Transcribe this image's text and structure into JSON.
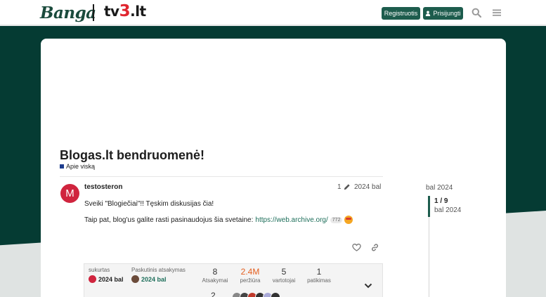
{
  "header": {
    "logo_left": "Banga",
    "logo_right_a": "tv",
    "logo_right_b": "3",
    "logo_right_c": ".lt",
    "register_label": "Registruotis",
    "login_label": "Prisijungti",
    "search_icon": "search-icon",
    "menu_icon": "hamburger-menu-icon"
  },
  "topic": {
    "title": "Blogas.lt bendruomenė!",
    "category": "Apie viską",
    "category_color": "#1e3d8e"
  },
  "post": {
    "avatar_letter": "M",
    "avatar_color": "#d0243e",
    "username": "testosteron",
    "edit_count": "1",
    "date": "2024 bal",
    "paragraph1": "Sveiki \"Blogiečiai\"!! Tęskim diskusijas čia!",
    "paragraph2_prefix": "Taip pat, blog'us galite rasti pasinaudojus šia svetaine: ",
    "link_text": "https://web.archive.org/",
    "link_clicks": "772"
  },
  "topic_map": {
    "created_label": "sukurtas",
    "created_value": "2024 bal",
    "last_reply_label": "Paskutinis atsakymas",
    "last_reply_value": "2024 bal",
    "stats": [
      {
        "value": "8",
        "label": "Atsakymai"
      },
      {
        "value": "2.4M",
        "label": "peržiūra"
      },
      {
        "value": "5",
        "label": "vartotojai"
      },
      {
        "value": "1",
        "label": "patikimas"
      }
    ],
    "partial_number": "2",
    "accent_hot": "#e45f1f"
  },
  "timeline": {
    "start_date": "bal 2024",
    "position": "1 / 9",
    "current_date": "bal 2024"
  }
}
